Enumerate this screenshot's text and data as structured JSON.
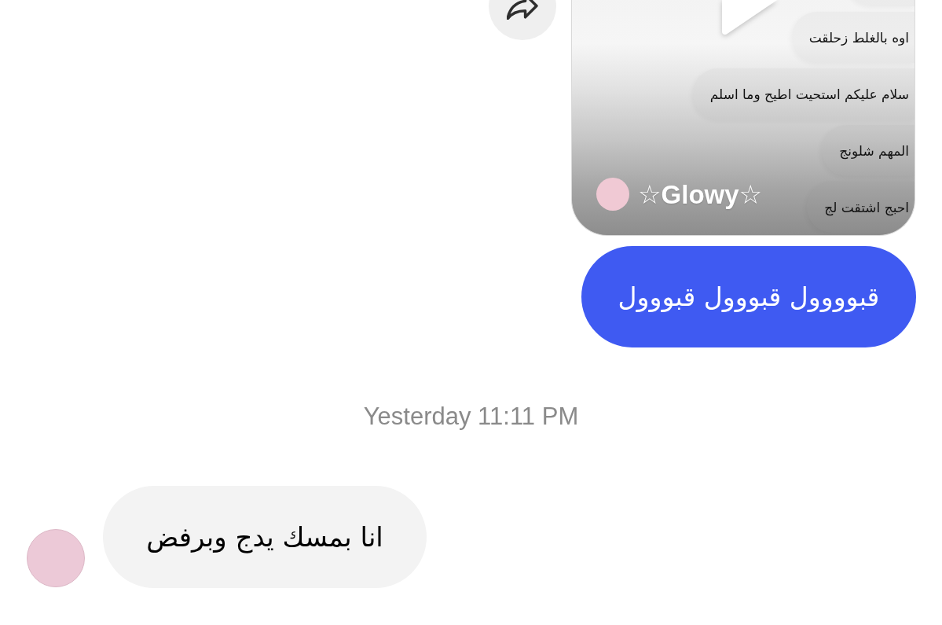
{
  "conversation": {
    "messages": [
      {
        "kind": "reel",
        "author": "☆Glowy☆",
        "frame_messages": [
          {
            "kind": "cut_off"
          },
          {
            "kind": "message",
            "text": "اوه بالغلط زحلقت"
          },
          {
            "kind": "message",
            "text": "سلام عليكم استحيت اطيح وما اسلم"
          },
          {
            "kind": "message",
            "text": "المهم شلونج"
          },
          {
            "kind": "message",
            "text": "احبج اشتقت لج"
          }
        ]
      },
      {
        "kind": "sent",
        "text": "قبوووول قبووول قبووول"
      },
      {
        "kind": "timestamp",
        "text": "Yesterday 11:11 PM"
      },
      {
        "kind": "received",
        "text": "انا بمسك يدج وبرفض"
      }
    ]
  }
}
